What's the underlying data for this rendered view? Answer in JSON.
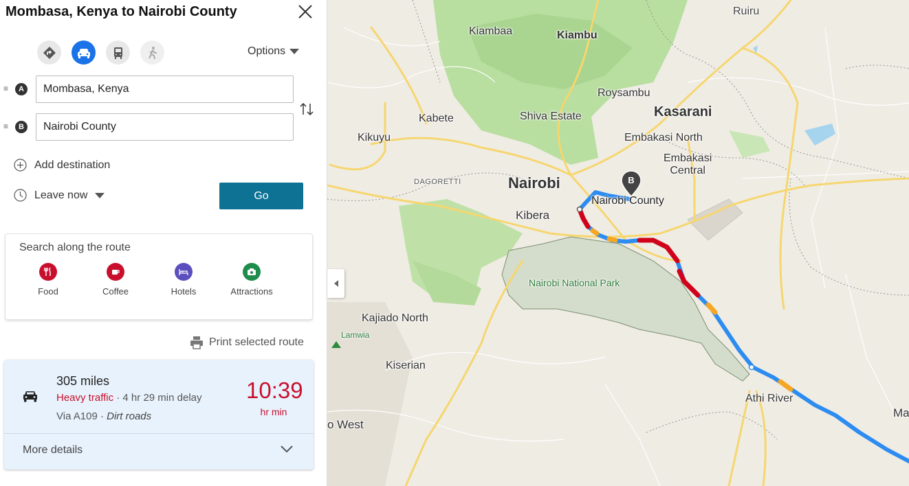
{
  "panel": {
    "title": "Mombasa, Kenya to Nairobi County",
    "modes": [
      "directions-icon",
      "car-icon",
      "transit-icon",
      "walk-icon"
    ],
    "active_mode": "car",
    "options_label": "Options",
    "waypoints": [
      {
        "pin": "A",
        "value": "Mombasa, Kenya"
      },
      {
        "pin": "B",
        "value": "Nairobi County"
      }
    ],
    "add_destination": "Add destination",
    "leave_now": "Leave now",
    "go_label": "Go",
    "search_along": {
      "title": "Search along the route",
      "categories": [
        {
          "label": "Food",
          "color": "#c8102e"
        },
        {
          "label": "Coffee",
          "color": "#c8102e"
        },
        {
          "label": "Hotels",
          "color": "#5b4fbf"
        },
        {
          "label": "Attractions",
          "color": "#1e8c4a"
        }
      ]
    },
    "print_label": "Print selected route",
    "route": {
      "distance": "305 miles",
      "traffic_status": "Heavy traffic",
      "delay": " · 4 hr 29 min delay",
      "via": "Via A109 ",
      "road_note": " · Dirt roads",
      "duration": "10:39",
      "duration_units": "hr min",
      "more_details": "More details"
    }
  },
  "map": {
    "labels": {
      "ruiru": "Ruiru",
      "kiambaa": "Kiambaa",
      "kiambu": "Kiambu",
      "roysambu": "Roysambu",
      "kasarani": "Kasarani",
      "kabete": "Kabete",
      "shiva": "Shiva Estate",
      "kikuyu": "Kikuyu",
      "embakasi_north": "Embakasi North",
      "embakasi_central_1": "Embakasi",
      "embakasi_central_2": "Central",
      "dagoretti": "DAGORETTI",
      "nairobi": "Nairobi",
      "destination": "Nairobi County",
      "kibera": "Kibera",
      "park": "Nairobi National Park",
      "kajiado": "Kajiado North",
      "lamwia": "Lamwia",
      "kiserian": "Kiserian",
      "athi": "Athi River",
      "west": "o West",
      "ma": "Ma"
    },
    "destination_pin": "B",
    "colors": {
      "route_blue": "#2d8cf0",
      "route_red": "#d0021b",
      "route_orange": "#f5a623",
      "park": "#d4dccb",
      "forest": "#b6dd9d"
    }
  }
}
